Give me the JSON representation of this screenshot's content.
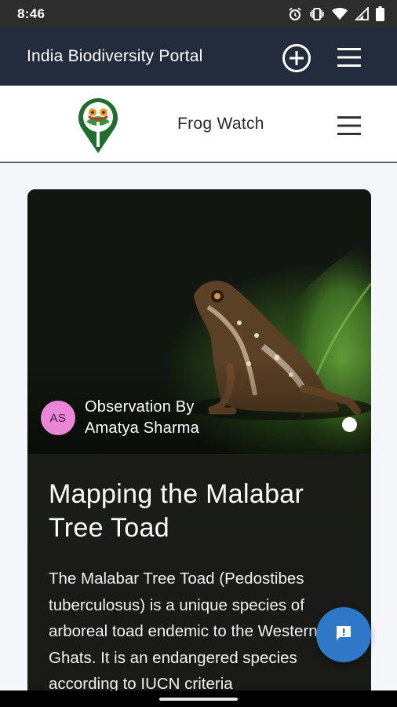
{
  "status_bar": {
    "time": "8:46",
    "icons": [
      "alarm-icon",
      "vibrate-icon",
      "wifi-icon",
      "signal-icon",
      "battery-icon"
    ]
  },
  "app_bar": {
    "title": "India Biodiversity Portal",
    "icons": [
      "add-circle-icon",
      "hamburger-menu-icon"
    ]
  },
  "site_header": {
    "name": "Frog Watch",
    "icons": [
      "frog-watch-logo",
      "hamburger-menu-icon"
    ]
  },
  "card": {
    "observer_label": "Observation By",
    "observer_name": "Amatya Sharma",
    "avatar_initials": "AS",
    "title": "Mapping the Malabar Tree Toad",
    "description": "The Malabar Tree Toad (Pedostibes tuberculosus) is a unique species of arboreal toad endemic to the Western Ghats. It is an endangered species according to IUCN criteria"
  },
  "fab": {
    "icon": "feedback-icon"
  },
  "colors": {
    "status_bar": "#2d2d2d",
    "app_bar": "#232c3d",
    "avatar": "#ea86d6",
    "fab": "#2f78c8",
    "page_background": "#f4f6f9"
  }
}
